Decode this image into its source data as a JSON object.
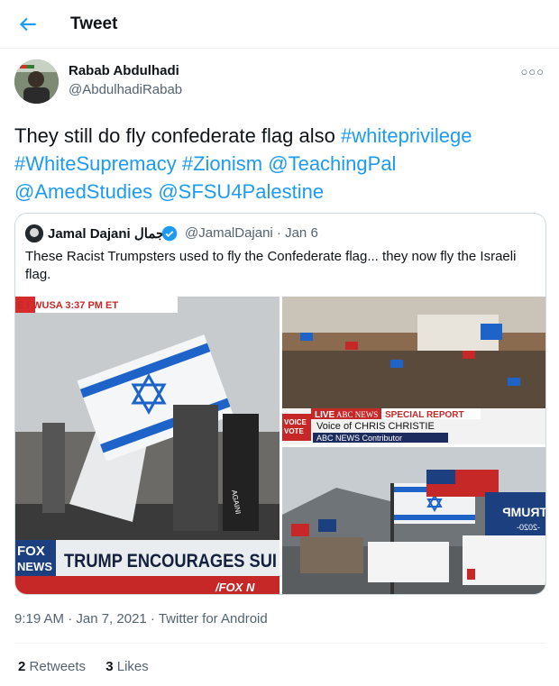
{
  "header": {
    "title": "Tweet"
  },
  "author": {
    "name": "Rabab Abdulhadi",
    "handle": "@AbdulhadiRabab"
  },
  "tweet": {
    "text_prefix": "They still do fly confederate flag also",
    "hashtags": [
      "#whiteprivilege",
      "#WhiteSupremacy",
      "#Zionism"
    ],
    "mentions": [
      "@TeachingPal",
      "@AmedStudies",
      "@SFSU4Palestine"
    ],
    "timestamp": "9:19 AM · Jan 7, 2021 · Twitter for Android"
  },
  "quoted": {
    "name": "Jamal Dajani جمال",
    "meta": "@JamalDajani · Jan 6",
    "text": "These Racist Trumpsters used to fly the Confederate flag... they now fly the Israeli flag.",
    "media": {
      "img1": {
        "banner_top": "E ! WUSA  3:37 PM ET",
        "logo1": "FOX",
        "logo2": "NEWS",
        "chyron": "TRUMP ENCOURAGES SUI",
        "sub_chyron": "/FOX N",
        "shirt": "AGAINI"
      },
      "img2": {
        "live": "LIVE",
        "network": "ABC NEWS",
        "special": "SPECIAL REPORT",
        "voice_logo": "VOICE",
        "voice_logo2": "VOTE",
        "guest": "Voice of CHRIS CHRISTIE",
        "role": "ABC NEWS Contributor"
      },
      "img3": {
        "trump_flag": "TRUMP",
        "year": "-2020-"
      }
    }
  },
  "stats": {
    "retweets_count": "2",
    "retweets_label": "Retweets",
    "likes_count": "3",
    "likes_label": "Likes"
  },
  "colors": {
    "accent": "#1d9bf0",
    "text": "#0f1419",
    "secondary": "#536471"
  }
}
